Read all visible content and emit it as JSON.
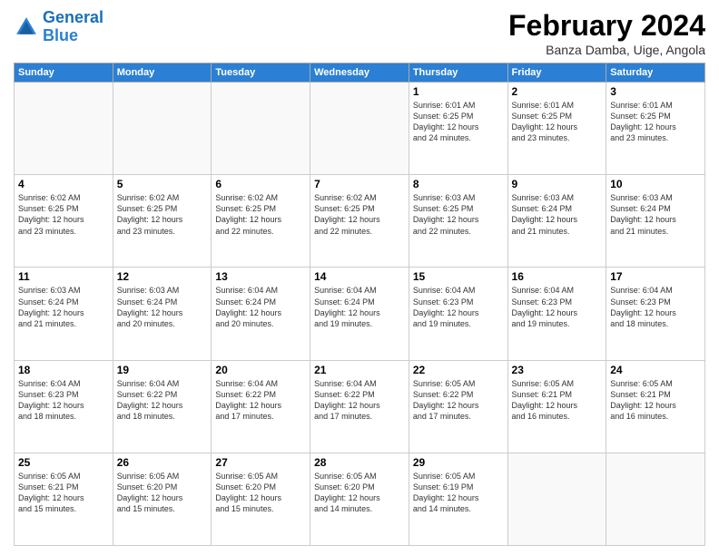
{
  "logo": {
    "line1": "General",
    "line2": "Blue"
  },
  "title": "February 2024",
  "subtitle": "Banza Damba, Uige, Angola",
  "weekdays": [
    "Sunday",
    "Monday",
    "Tuesday",
    "Wednesday",
    "Thursday",
    "Friday",
    "Saturday"
  ],
  "weeks": [
    [
      {
        "day": "",
        "info": ""
      },
      {
        "day": "",
        "info": ""
      },
      {
        "day": "",
        "info": ""
      },
      {
        "day": "",
        "info": ""
      },
      {
        "day": "1",
        "info": "Sunrise: 6:01 AM\nSunset: 6:25 PM\nDaylight: 12 hours\nand 24 minutes."
      },
      {
        "day": "2",
        "info": "Sunrise: 6:01 AM\nSunset: 6:25 PM\nDaylight: 12 hours\nand 23 minutes."
      },
      {
        "day": "3",
        "info": "Sunrise: 6:01 AM\nSunset: 6:25 PM\nDaylight: 12 hours\nand 23 minutes."
      }
    ],
    [
      {
        "day": "4",
        "info": "Sunrise: 6:02 AM\nSunset: 6:25 PM\nDaylight: 12 hours\nand 23 minutes."
      },
      {
        "day": "5",
        "info": "Sunrise: 6:02 AM\nSunset: 6:25 PM\nDaylight: 12 hours\nand 23 minutes."
      },
      {
        "day": "6",
        "info": "Sunrise: 6:02 AM\nSunset: 6:25 PM\nDaylight: 12 hours\nand 22 minutes."
      },
      {
        "day": "7",
        "info": "Sunrise: 6:02 AM\nSunset: 6:25 PM\nDaylight: 12 hours\nand 22 minutes."
      },
      {
        "day": "8",
        "info": "Sunrise: 6:03 AM\nSunset: 6:25 PM\nDaylight: 12 hours\nand 22 minutes."
      },
      {
        "day": "9",
        "info": "Sunrise: 6:03 AM\nSunset: 6:24 PM\nDaylight: 12 hours\nand 21 minutes."
      },
      {
        "day": "10",
        "info": "Sunrise: 6:03 AM\nSunset: 6:24 PM\nDaylight: 12 hours\nand 21 minutes."
      }
    ],
    [
      {
        "day": "11",
        "info": "Sunrise: 6:03 AM\nSunset: 6:24 PM\nDaylight: 12 hours\nand 21 minutes."
      },
      {
        "day": "12",
        "info": "Sunrise: 6:03 AM\nSunset: 6:24 PM\nDaylight: 12 hours\nand 20 minutes."
      },
      {
        "day": "13",
        "info": "Sunrise: 6:04 AM\nSunset: 6:24 PM\nDaylight: 12 hours\nand 20 minutes."
      },
      {
        "day": "14",
        "info": "Sunrise: 6:04 AM\nSunset: 6:24 PM\nDaylight: 12 hours\nand 19 minutes."
      },
      {
        "day": "15",
        "info": "Sunrise: 6:04 AM\nSunset: 6:23 PM\nDaylight: 12 hours\nand 19 minutes."
      },
      {
        "day": "16",
        "info": "Sunrise: 6:04 AM\nSunset: 6:23 PM\nDaylight: 12 hours\nand 19 minutes."
      },
      {
        "day": "17",
        "info": "Sunrise: 6:04 AM\nSunset: 6:23 PM\nDaylight: 12 hours\nand 18 minutes."
      }
    ],
    [
      {
        "day": "18",
        "info": "Sunrise: 6:04 AM\nSunset: 6:23 PM\nDaylight: 12 hours\nand 18 minutes."
      },
      {
        "day": "19",
        "info": "Sunrise: 6:04 AM\nSunset: 6:22 PM\nDaylight: 12 hours\nand 18 minutes."
      },
      {
        "day": "20",
        "info": "Sunrise: 6:04 AM\nSunset: 6:22 PM\nDaylight: 12 hours\nand 17 minutes."
      },
      {
        "day": "21",
        "info": "Sunrise: 6:04 AM\nSunset: 6:22 PM\nDaylight: 12 hours\nand 17 minutes."
      },
      {
        "day": "22",
        "info": "Sunrise: 6:05 AM\nSunset: 6:22 PM\nDaylight: 12 hours\nand 17 minutes."
      },
      {
        "day": "23",
        "info": "Sunrise: 6:05 AM\nSunset: 6:21 PM\nDaylight: 12 hours\nand 16 minutes."
      },
      {
        "day": "24",
        "info": "Sunrise: 6:05 AM\nSunset: 6:21 PM\nDaylight: 12 hours\nand 16 minutes."
      }
    ],
    [
      {
        "day": "25",
        "info": "Sunrise: 6:05 AM\nSunset: 6:21 PM\nDaylight: 12 hours\nand 15 minutes."
      },
      {
        "day": "26",
        "info": "Sunrise: 6:05 AM\nSunset: 6:20 PM\nDaylight: 12 hours\nand 15 minutes."
      },
      {
        "day": "27",
        "info": "Sunrise: 6:05 AM\nSunset: 6:20 PM\nDaylight: 12 hours\nand 15 minutes."
      },
      {
        "day": "28",
        "info": "Sunrise: 6:05 AM\nSunset: 6:20 PM\nDaylight: 12 hours\nand 14 minutes."
      },
      {
        "day": "29",
        "info": "Sunrise: 6:05 AM\nSunset: 6:19 PM\nDaylight: 12 hours\nand 14 minutes."
      },
      {
        "day": "",
        "info": ""
      },
      {
        "day": "",
        "info": ""
      }
    ]
  ]
}
